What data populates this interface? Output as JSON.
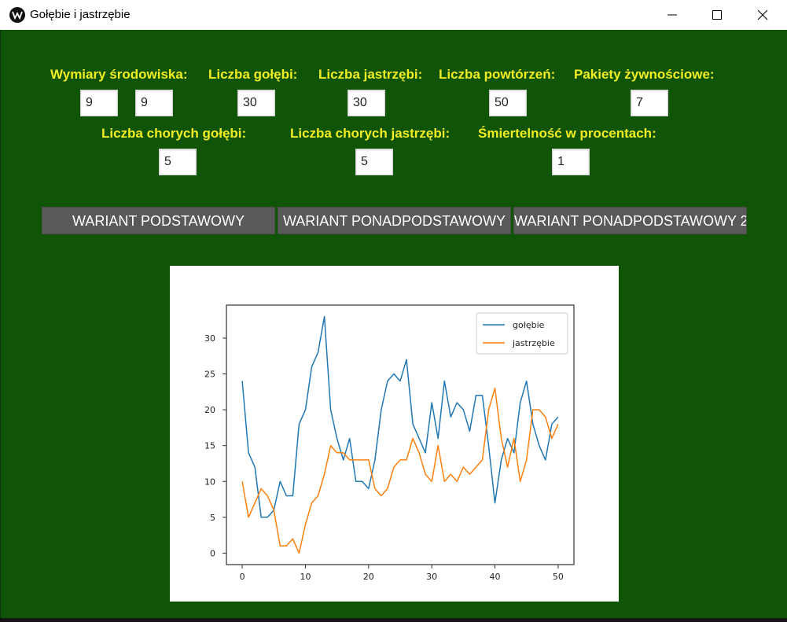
{
  "window": {
    "title": "Gołębie i jastrzębie"
  },
  "labels": {
    "dims": "Wymiary środowiska:",
    "doves": "Liczba gołębi:",
    "hawks": "Liczba jastrzębi:",
    "reps": "Liczba powtórzeń:",
    "food": "Pakiety żywnościowe:",
    "sick_doves": "Liczba chorych gołębi:",
    "sick_hawks": "Liczba chorych jastrzębi:",
    "mortality": "Śmiertelność w procentach:"
  },
  "fields": {
    "dim_x": "9",
    "dim_y": "9",
    "doves": "30",
    "hawks": "30",
    "reps": "50",
    "food": "7",
    "sick_doves": "5",
    "sick_hawks": "5",
    "mortality": "1"
  },
  "buttons": {
    "basic": "WARIANT PODSTAWOWY",
    "advanced": "WARIANT PONADPODSTAWOWY",
    "advanced2": "WARIANT PONADPODSTAWOWY 2"
  },
  "colors": {
    "background": "#105407",
    "label": "#f2ee22",
    "button": "#595959",
    "series_doves": "#1f77b4",
    "series_hawks": "#ff7f0e"
  },
  "chart_data": {
    "type": "line",
    "x": [
      0,
      1,
      2,
      3,
      4,
      5,
      6,
      7,
      8,
      9,
      10,
      11,
      12,
      13,
      14,
      15,
      16,
      17,
      18,
      19,
      20,
      21,
      22,
      23,
      24,
      25,
      26,
      27,
      28,
      29,
      30,
      31,
      32,
      33,
      34,
      35,
      36,
      37,
      38,
      39,
      40,
      41,
      42,
      43,
      44,
      45,
      46,
      47,
      48,
      49,
      50
    ],
    "series": [
      {
        "name": "gołębie",
        "color": "#1f77b4",
        "values": [
          24,
          14,
          12,
          5,
          5,
          6,
          10,
          8,
          8,
          18,
          20,
          26,
          28,
          33,
          20,
          16,
          13,
          16,
          10,
          10,
          9,
          13,
          20,
          24,
          25,
          24,
          27,
          18,
          16,
          14,
          21,
          16,
          24,
          19,
          21,
          20,
          17,
          22,
          22,
          15,
          7,
          13,
          16,
          14,
          21,
          24,
          18,
          15,
          13,
          18,
          19
        ]
      },
      {
        "name": "jastrzębie",
        "color": "#ff7f0e",
        "values": [
          10,
          5,
          7,
          9,
          8,
          6,
          1,
          1,
          2,
          0,
          4,
          7,
          8,
          11,
          15,
          14,
          14,
          13,
          13,
          13,
          13,
          9,
          8,
          9,
          12,
          13,
          13,
          16,
          14,
          11,
          10,
          15,
          10,
          11,
          10,
          12,
          11,
          12,
          13,
          20,
          23,
          16,
          12,
          16,
          10,
          13,
          20,
          20,
          19,
          16,
          18
        ]
      }
    ],
    "xticks": [
      0,
      10,
      20,
      30,
      40,
      50
    ],
    "yticks": [
      0,
      5,
      10,
      15,
      20,
      25,
      30
    ],
    "xlim": [
      -2.5,
      52.5
    ],
    "ylim": [
      -1.6,
      34.6
    ],
    "legend": "top-right",
    "grid": false
  }
}
